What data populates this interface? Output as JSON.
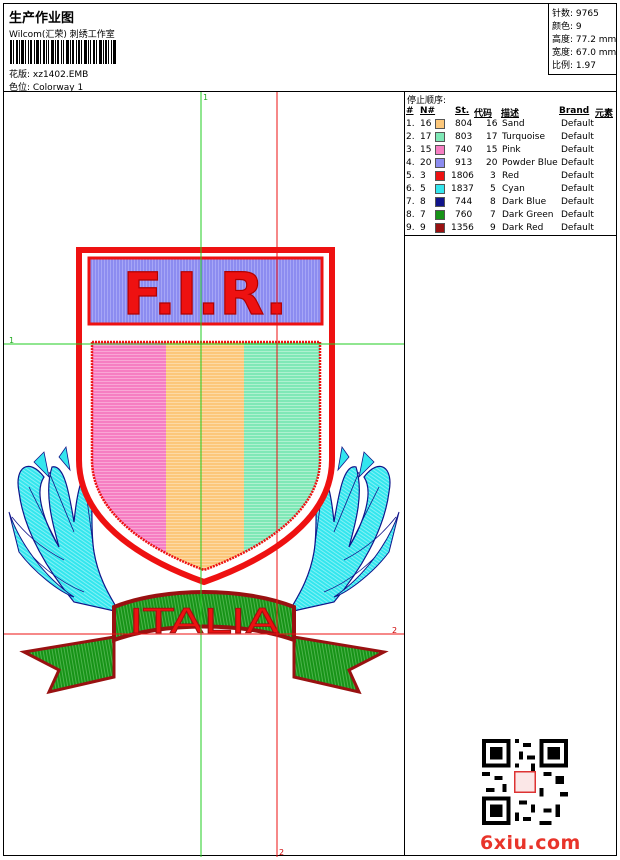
{
  "header": {
    "title": "生产作业图",
    "subtitle": "Wilcom(汇荣) 刺绣工作室",
    "file_label": "花版: xz1402.EMB",
    "colorway_label": "色位: Colorway 1"
  },
  "stats": {
    "stitches": "针数: 9765",
    "colors": "颜色: 9",
    "height": "高度: 77.2 mm",
    "width": "宽度: 67.0 mm",
    "scale": "比例: 1.97"
  },
  "stop_sequence": {
    "title": "停止顺序:",
    "headers": {
      "idx": "#",
      "n": "N#",
      "st": "St.",
      "code": "代码",
      "desc": "描述",
      "brand": "Brand",
      "elem": "元素"
    },
    "rows": [
      {
        "idx": "1.",
        "n": "16",
        "st": "804",
        "code": "16",
        "desc": "Sand",
        "brand": "Default",
        "color": "#fcc77a"
      },
      {
        "idx": "2.",
        "n": "17",
        "st": "803",
        "code": "17",
        "desc": "Turquoise",
        "brand": "Default",
        "color": "#7fe8b6"
      },
      {
        "idx": "3.",
        "n": "15",
        "st": "740",
        "code": "15",
        "desc": "Pink",
        "brand": "Default",
        "color": "#f67ec2"
      },
      {
        "idx": "4.",
        "n": "20",
        "st": "913",
        "code": "20",
        "desc": "Powder Blue",
        "brand": "Default",
        "color": "#8c8cf0"
      },
      {
        "idx": "5.",
        "n": "3",
        "st": "1806",
        "code": "3",
        "desc": "Red",
        "brand": "Default",
        "color": "#ee1111"
      },
      {
        "idx": "6.",
        "n": "5",
        "st": "1837",
        "code": "5",
        "desc": "Cyan",
        "brand": "Default",
        "color": "#33e6ee"
      },
      {
        "idx": "7.",
        "n": "8",
        "st": "744",
        "code": "8",
        "desc": "Dark Blue",
        "brand": "Default",
        "color": "#10148a"
      },
      {
        "idx": "8.",
        "n": "7",
        "st": "760",
        "code": "7",
        "desc": "Dark Green",
        "brand": "Default",
        "color": "#179317"
      },
      {
        "idx": "9.",
        "n": "9",
        "st": "1356",
        "code": "9",
        "desc": "Dark Red",
        "brand": "Default",
        "color": "#991111"
      }
    ]
  },
  "design": {
    "shield_text": "F.I.R.",
    "ribbon_text": "ITALIA",
    "guide_labels": {
      "green_v": "1",
      "green_h": "1",
      "red_h": "2",
      "red_v": "2"
    }
  },
  "watermark": "6xiu.com"
}
